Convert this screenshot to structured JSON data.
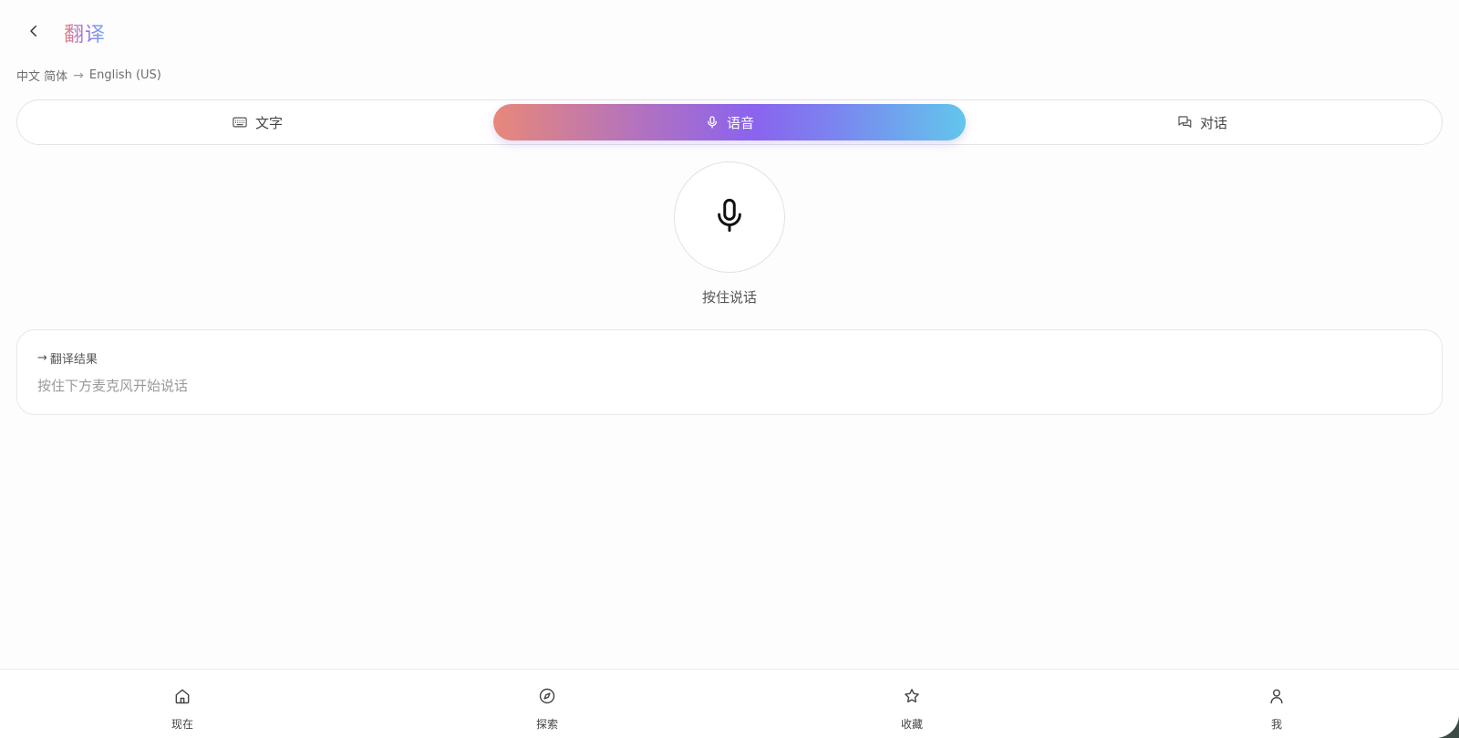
{
  "header": {
    "title": "翻译",
    "back_icon": "chevron-left-icon"
  },
  "language": {
    "source": "中文 简体",
    "arrow": "→",
    "target": "English (US)"
  },
  "tabs": [
    {
      "label": "文字",
      "icon": "keyboard-icon",
      "active": false
    },
    {
      "label": "语音",
      "icon": "microphone-icon",
      "active": true
    },
    {
      "label": "对话",
      "icon": "chat-bubbles-icon",
      "active": false
    }
  ],
  "voice": {
    "mic_icon": "microphone-icon",
    "hint": "按住说话"
  },
  "result": {
    "label_arrow": "→",
    "label": "翻译结果",
    "placeholder": "按住下方麦克风开始说话"
  },
  "bottom_nav": [
    {
      "label": "现在",
      "icon": "home-icon"
    },
    {
      "label": "探索",
      "icon": "compass-icon"
    },
    {
      "label": "收藏",
      "icon": "star-icon"
    },
    {
      "label": "我",
      "icon": "user-icon"
    }
  ],
  "colors": {
    "gradient_start": "#e8887a",
    "gradient_mid": "#8a63ee",
    "gradient_end": "#62c6ec",
    "background": "#fdfdfd",
    "text_secondary": "#9a9a9a"
  }
}
